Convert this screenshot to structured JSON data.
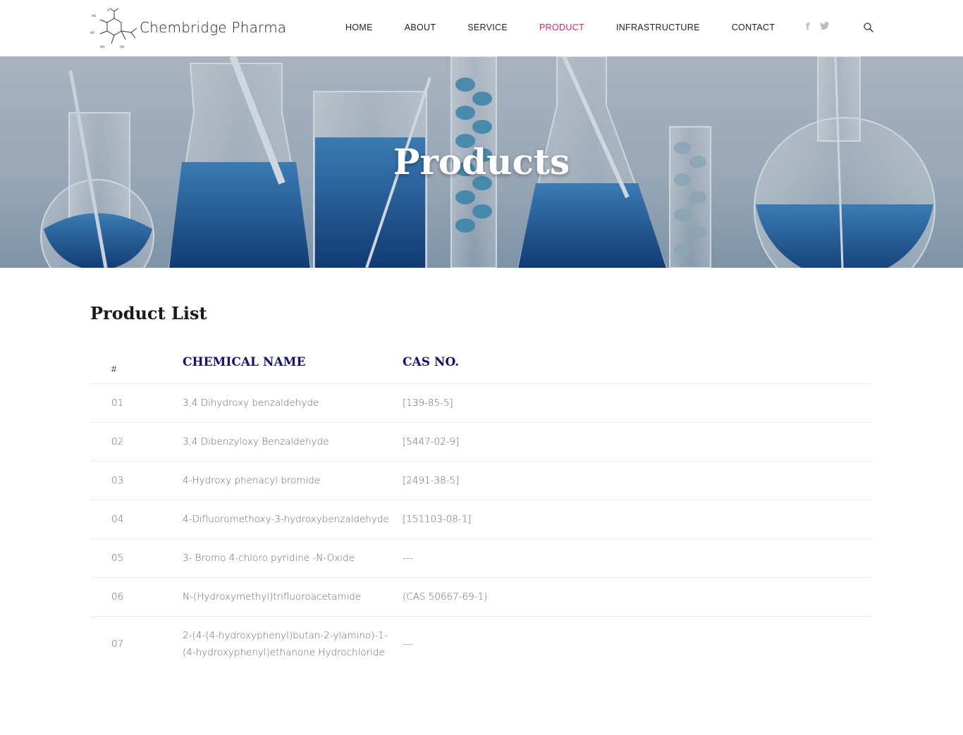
{
  "header": {
    "brand": "Chembridge Pharma",
    "nav": [
      {
        "label": "HOME",
        "active": false
      },
      {
        "label": "ABOUT",
        "active": false
      },
      {
        "label": "SERVICE",
        "active": false
      },
      {
        "label": "PRODUCT",
        "active": true
      },
      {
        "label": "INFRASTRUCTURE",
        "active": false
      },
      {
        "label": "CONTACT",
        "active": false
      }
    ],
    "social": [
      {
        "icon": "facebook-icon",
        "glyph": "f"
      },
      {
        "icon": "twitter-icon",
        "glyph": "t"
      }
    ],
    "search_icon": "search-icon",
    "active_color": "#e0245e"
  },
  "hero": {
    "title": "Products"
  },
  "content": {
    "title": "Product List",
    "table": {
      "headers": {
        "num": "#",
        "name": "CHEMICAL NAME",
        "cas": "CAS NO."
      },
      "header_color": "#10107a",
      "rows": [
        {
          "num": "01",
          "name": "3,4 Dihydroxy benzaldehyde",
          "cas": "[139-85-5]"
        },
        {
          "num": "02",
          "name": "3,4 Dibenzyloxy Benzaldehyde",
          "cas": "[5447-02-9]"
        },
        {
          "num": "03",
          "name": "4-Hydroxy phenacyl bromide",
          "cas": "[2491-38-5]"
        },
        {
          "num": "04",
          "name": "4-Difluoromethoxy-3-hydroxybenzaldehyde",
          "cas": "[151103-08-1]"
        },
        {
          "num": "05",
          "name": "3- Bromo 4-chloro pyridine -N-Oxide",
          "cas": "---"
        },
        {
          "num": "06",
          "name": "N-(Hydroxymethyl)trifluoroacetamide",
          "cas": "(CAS 50667-69-1)"
        },
        {
          "num": "07",
          "name": "2-(4-(4-hydroxyphenyl)butan-2-ylamino)-1-(4-hydroxyphenyl)ethanone Hydrochloride",
          "cas": "---"
        }
      ]
    }
  }
}
